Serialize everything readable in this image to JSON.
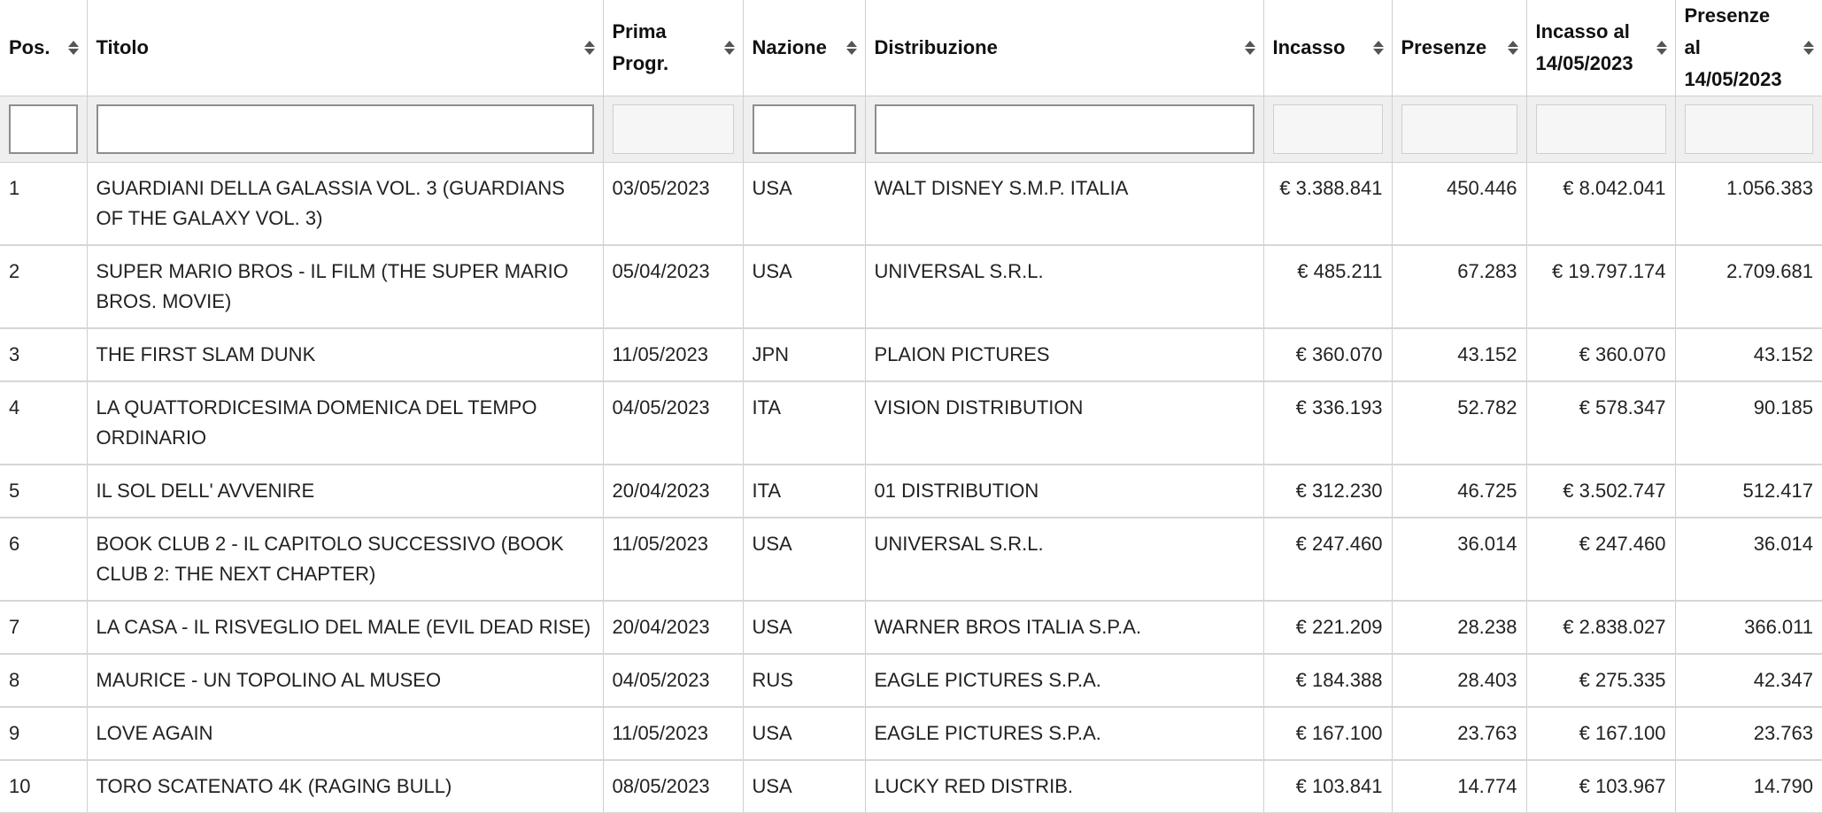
{
  "columns": [
    {
      "label": "Pos."
    },
    {
      "label": "Titolo"
    },
    {
      "label": "Prima Progr."
    },
    {
      "label": "Nazione"
    },
    {
      "label": "Distribuzione"
    },
    {
      "label": "Incasso"
    },
    {
      "label": "Presenze"
    },
    {
      "label": "Incasso al 14/05/2023"
    },
    {
      "label": "Presenze al 14/05/2023"
    }
  ],
  "rows": [
    [
      "1",
      "GUARDIANI DELLA GALASSIA VOL. 3 (GUARDIANS OF THE GALAXY VOL. 3)",
      "03/05/2023",
      "USA",
      "WALT DISNEY S.M.P. ITALIA",
      "€ 3.388.841",
      "450.446",
      "€ 8.042.041",
      "1.056.383"
    ],
    [
      "2",
      "SUPER MARIO BROS - IL FILM (THE SUPER MARIO BROS. MOVIE)",
      "05/04/2023",
      "USA",
      "UNIVERSAL S.R.L.",
      "€ 485.211",
      "67.283",
      "€ 19.797.174",
      "2.709.681"
    ],
    [
      "3",
      "THE FIRST SLAM DUNK",
      "11/05/2023",
      "JPN",
      "PLAION PICTURES",
      "€ 360.070",
      "43.152",
      "€ 360.070",
      "43.152"
    ],
    [
      "4",
      "LA QUATTORDICESIMA DOMENICA DEL TEMPO ORDINARIO",
      "04/05/2023",
      "ITA",
      "VISION DISTRIBUTION",
      "€ 336.193",
      "52.782",
      "€ 578.347",
      "90.185"
    ],
    [
      "5",
      "IL SOL DELL' AVVENIRE",
      "20/04/2023",
      "ITA",
      "01 DISTRIBUTION",
      "€ 312.230",
      "46.725",
      "€ 3.502.747",
      "512.417"
    ],
    [
      "6",
      "BOOK CLUB 2 - IL CAPITOLO SUCCESSIVO (BOOK CLUB 2: THE NEXT CHAPTER)",
      "11/05/2023",
      "USA",
      "UNIVERSAL S.R.L.",
      "€ 247.460",
      "36.014",
      "€ 247.460",
      "36.014"
    ],
    [
      "7",
      "LA CASA - IL RISVEGLIO DEL MALE (EVIL DEAD RISE)",
      "20/04/2023",
      "USA",
      "WARNER BROS ITALIA S.P.A.",
      "€ 221.209",
      "28.238",
      "€ 2.838.027",
      "366.011"
    ],
    [
      "8",
      "MAURICE - UN TOPOLINO AL MUSEO",
      "04/05/2023",
      "RUS",
      "EAGLE PICTURES S.P.A.",
      "€ 184.388",
      "28.403",
      "€ 275.335",
      "42.347"
    ],
    [
      "9",
      "LOVE AGAIN",
      "11/05/2023",
      "USA",
      "EAGLE PICTURES S.P.A.",
      "€ 167.100",
      "23.763",
      "€ 167.100",
      "23.763"
    ],
    [
      "10",
      "TORO SCATENATO 4K (RAGING BULL)",
      "08/05/2023",
      "USA",
      "LUCKY RED DISTRIB.",
      "€ 103.841",
      "14.774",
      "€ 103.967",
      "14.790"
    ]
  ]
}
